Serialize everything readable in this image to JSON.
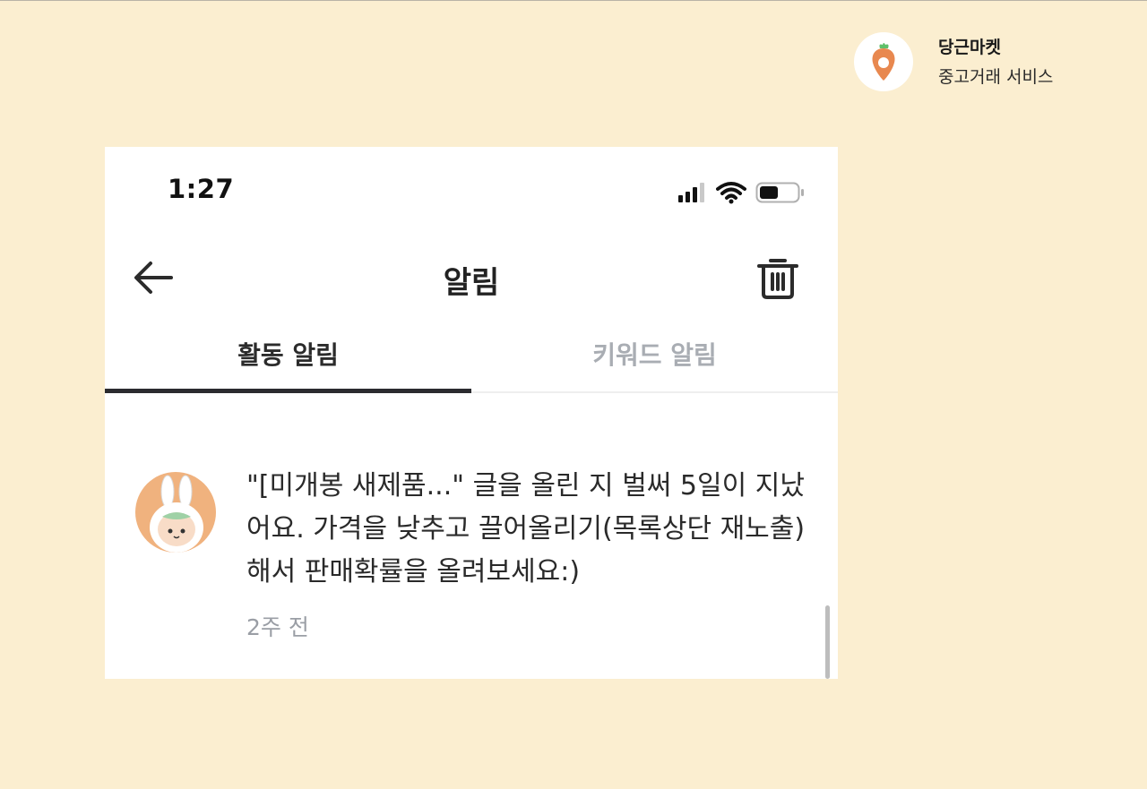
{
  "brand": {
    "name": "당근마켓",
    "subtitle": "중고거래 서비스"
  },
  "status_bar": {
    "time": "1:27",
    "icons": [
      "cellular-signal-icon",
      "wifi-icon",
      "battery-icon"
    ]
  },
  "header": {
    "back_icon": "arrow-left-icon",
    "title": "알림",
    "trash_icon": "trash-icon"
  },
  "tabs": [
    {
      "label": "활동 알림",
      "active": true
    },
    {
      "label": "키워드 알림",
      "active": false
    }
  ],
  "notifications": [
    {
      "avatar": "bunny-character-avatar",
      "text": "\"[미개봉 새제품...\" 글을 올린 지 벌써 5일이 지났어요. 가격을 낮추고 끌어올리기(목록상단 재노출)해서 판매확률을 올려보세요:)",
      "time": "2주 전"
    }
  ],
  "colors": {
    "background": "#fbeed0",
    "brand_orange": "#e8884f",
    "tab_active": "#2b2b2f",
    "tab_inactive": "#a9adb3",
    "timestamp": "#9a9ea5"
  }
}
